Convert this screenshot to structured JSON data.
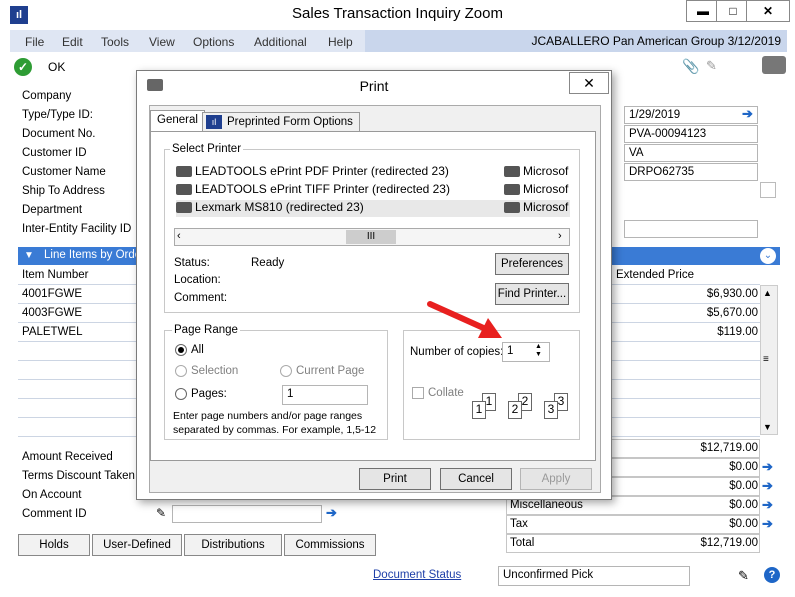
{
  "window": {
    "title": "Sales Transaction Inquiry Zoom",
    "user_info": "JCABALLERO  Pan American Group  3/12/2019",
    "minimize": "▬",
    "maximize": "□",
    "close": "✕"
  },
  "menu": [
    "File",
    "Edit",
    "Tools",
    "View",
    "Options",
    "Additional",
    "Help"
  ],
  "toolbar": {
    "ok_label": "OK"
  },
  "fields": {
    "company": "Company",
    "type_id": "Type/Type ID:",
    "document_no": "Document No.",
    "customer_id": "Customer ID",
    "customer_name": "Customer Name",
    "ship_to": "Ship To Address",
    "department": "Department",
    "inter_entity": "Inter-Entity Facility ID"
  },
  "right_values": {
    "date": "1/29/2019",
    "doc_no": "PVA-00094123",
    "customer_id_val": "VA",
    "customer_name_val": "DRPO62735"
  },
  "line_items": {
    "header": "Line Items by Order",
    "col_item": "Item Number",
    "col_price": "Extended Price",
    "rows": [
      {
        "item": "4001FGWE",
        "price": "$6,930.00"
      },
      {
        "item": "4003FGWE",
        "price": "$5,670.00"
      },
      {
        "item": "PALETWEL",
        "price": "$119.00"
      }
    ]
  },
  "amounts": {
    "amount_received": "Amount Received",
    "terms_discount": "Terms Discount Taken",
    "on_account": "On Account",
    "comment_id": "Comment ID",
    "subtotal": "$12,719.00",
    "v1": "$0.00",
    "v2": "$0.00",
    "misc_label": "Miscellaneous",
    "misc": "$0.00",
    "tax_label": "Tax",
    "tax": "$0.00",
    "total_label": "Total",
    "total": "$12,719.00"
  },
  "bottom_buttons": {
    "holds": "Holds",
    "user_defined": "User-Defined",
    "distributions": "Distributions",
    "commissions": "Commissions"
  },
  "footer": {
    "document_status": "Document Status",
    "status_value": "Unconfirmed Pick"
  },
  "dialog": {
    "title": "Print",
    "close": "✕",
    "tabs": [
      "General",
      "Preprinted Form Options"
    ],
    "select_printer": "Select Printer",
    "printers": [
      {
        "name": "LEADTOOLS ePrint PDF Printer (redirected 23)",
        "extra": "Microsof"
      },
      {
        "name": "LEADTOOLS ePrint TIFF Printer (redirected 23)",
        "extra": "Microsof"
      },
      {
        "name": "Lexmark MS810 (redirected 23)",
        "extra": "Microsof"
      }
    ],
    "scroll_thumb": "III",
    "status_label": "Status:",
    "status_value": "Ready",
    "location_label": "Location:",
    "comment_label": "Comment:",
    "preferences": "Preferences",
    "find_printer": "Find Printer...",
    "page_range": "Page Range",
    "all": "All",
    "selection": "Selection",
    "current_page": "Current Page",
    "pages": "Pages:",
    "pages_value": "1",
    "pages_hint_1": "Enter page numbers and/or page ranges",
    "pages_hint_2": "separated by commas.  For example, 1,5-12",
    "copies_label": "Number of copies:",
    "copies_value": "1",
    "collate": "Collate",
    "print": "Print",
    "cancel": "Cancel",
    "apply": "Apply"
  },
  "colors": {
    "accent": "#3a7bd5",
    "arrow": "#e8201f",
    "ok": "#2e9c34"
  }
}
